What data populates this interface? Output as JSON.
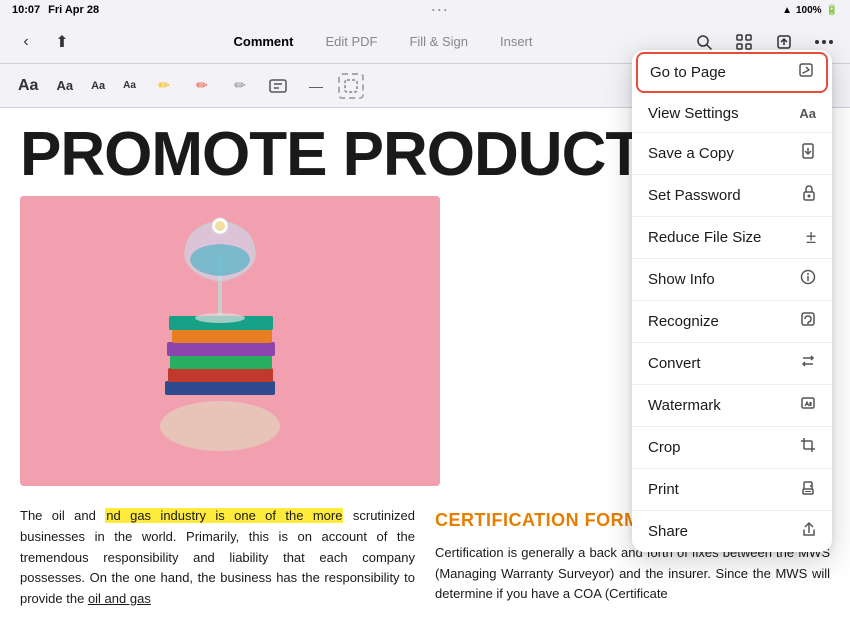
{
  "statusBar": {
    "time": "10:07",
    "day": "Fri Apr 28",
    "battery": "100%",
    "wifi": "WiFi"
  },
  "toolbar": {
    "backLabel": "‹",
    "shareLabel": "↑",
    "tabs": [
      {
        "label": "Comment",
        "active": true
      },
      {
        "label": "Edit PDF",
        "active": false
      },
      {
        "label": "Fill & Sign",
        "active": false
      },
      {
        "label": "Insert",
        "active": false
      }
    ],
    "rightIcons": [
      "search",
      "grid",
      "export",
      "more"
    ]
  },
  "subToolbar": {
    "items": [
      {
        "label": "Aa",
        "size": "large"
      },
      {
        "label": "Aa",
        "size": "medium"
      },
      {
        "label": "Aa",
        "size": "small"
      },
      {
        "label": "Aa",
        "size": "xsmall"
      },
      {
        "label": "✏️"
      },
      {
        "label": "✏️"
      },
      {
        "label": "✏️"
      },
      {
        "label": "T"
      },
      {
        "label": "—"
      },
      {
        "label": "⬜"
      }
    ]
  },
  "pageContent": {
    "title": "PROMOTE PRODUCTIV",
    "highlightedText": "nd gas industry is one of the more",
    "bodyText1a": "The oil and ",
    "bodyText1b": " scrutinized businesses in the world. Primarily, this is on account of the tremendous responsibility and liability that each company possesses. On the one hand, the business has the responsibility to provide the oil and gas",
    "certTitle": "CERTIFICATION FORMS",
    "certText": "Certification is generally a back and forth of fixes between the MWS (Managing Warranty Surveyor) and the insurer. Since the MWS will determine if you have a COA (Certificate"
  },
  "dropdownMenu": {
    "items": [
      {
        "label": "Go to Page",
        "icon": "↗",
        "active": true
      },
      {
        "label": "View Settings",
        "icon": "Aa"
      },
      {
        "label": "Save a Copy",
        "icon": "📄"
      },
      {
        "label": "Set Password",
        "icon": "🔒"
      },
      {
        "label": "Reduce File Size",
        "icon": "±"
      },
      {
        "label": "Show Info",
        "icon": "ℹ"
      },
      {
        "label": "Recognize",
        "icon": "⟳"
      },
      {
        "label": "Convert",
        "icon": "⇄"
      },
      {
        "label": "Watermark",
        "icon": "🖼"
      },
      {
        "label": "Crop",
        "icon": "⊡"
      },
      {
        "label": "Print",
        "icon": "🖨"
      },
      {
        "label": "Share",
        "icon": "↑"
      }
    ]
  }
}
